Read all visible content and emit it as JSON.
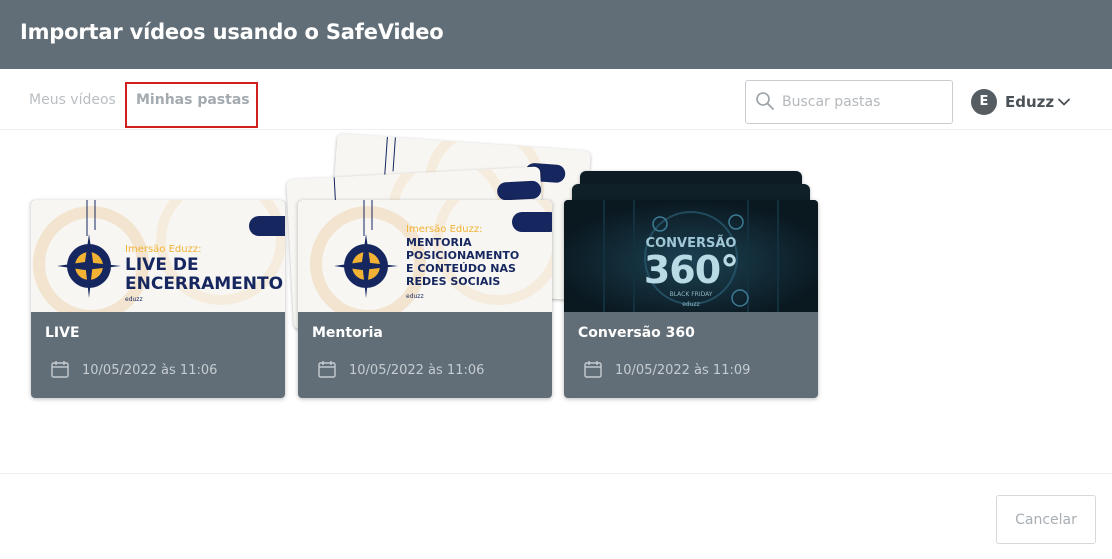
{
  "header": {
    "title": "Importar vídeos usando o SafeVideo"
  },
  "tabs": [
    {
      "label": "Meus vídeos",
      "active": false
    },
    {
      "label": "Minhas pastas",
      "active": true
    }
  ],
  "search": {
    "placeholder": "Buscar pastas",
    "value": ""
  },
  "account": {
    "initial": "E",
    "name": "Eduzz"
  },
  "folders": [
    {
      "name": "LIVE",
      "date": "10/05/2022 às 11:06",
      "thumb": {
        "kicker": "Imersão Eduzz:",
        "lines": [
          "LIVE DE",
          "ENCERRAMENTO"
        ],
        "brand": "eduzz"
      }
    },
    {
      "name": "Mentoria",
      "date": "10/05/2022 às 11:06",
      "thumb": {
        "kicker": "Imersão Eduzz:",
        "lines": [
          "MENTORIA",
          "POSICIONAMENTO",
          "E CONTEÚDO NAS",
          "REDES SOCIAIS"
        ],
        "brand": "eduzz"
      }
    },
    {
      "name": "Conversão 360",
      "date": "10/05/2022 às 11:09",
      "thumb": {
        "lines": [
          "CONVERSÃO",
          "360°"
        ],
        "sub": "BLACK FRIDAY",
        "brand": "eduzz"
      }
    }
  ],
  "footer": {
    "cancel_label": "Cancelar"
  },
  "colors": {
    "header": "#616e77",
    "card": "#616e77",
    "highlight": "#d0201c",
    "navy": "#16275f",
    "gold": "#f2b233"
  }
}
